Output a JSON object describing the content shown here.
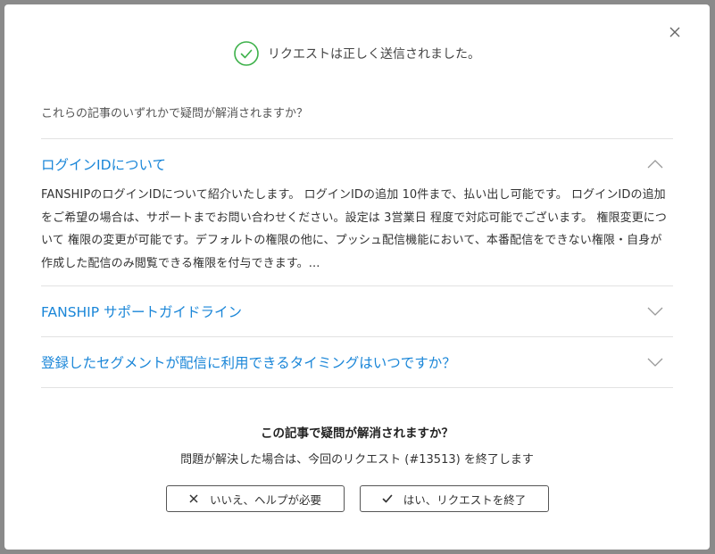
{
  "status": {
    "message": "リクエストは正しく送信されました。",
    "icon": "check-circle-icon",
    "color": "#3db14a"
  },
  "question": "これらの記事のいずれかで疑問が解消されますか？",
  "articles": [
    {
      "title": "ログインIDについて",
      "expanded": true,
      "body": "FANSHIPのログインIDについて紹介いたします。 ログインIDの追加 10件まで、払い出し可能です。 ログインIDの追加をご希望の場合は、サポートまでお問い合わせください。設定は 3営業日 程度で対応可能でございます。 権限変更について 権限の変更が可能です。デフォルトの権限の他に、プッシュ配信機能において、本番配信をできない権限・自身が作成した配信のみ閲覧できる権限を付与できます。..."
    },
    {
      "title": "FANSHIP サポートガイドライン",
      "expanded": false
    },
    {
      "title": "登録したセグメントが配信に利用できるタイミングはいつですか？",
      "expanded": false
    }
  ],
  "confirm": {
    "title": "この記事で疑問が解消されますか？",
    "subtitle": "問題が解決した場合は、今回のリクエスト (#13513) を終了します"
  },
  "buttons": {
    "no_label": "いいえ、ヘルプが必要",
    "yes_label": "はい、リクエストを終了"
  },
  "colors": {
    "link": "#1a86d8",
    "success": "#3db14a"
  }
}
